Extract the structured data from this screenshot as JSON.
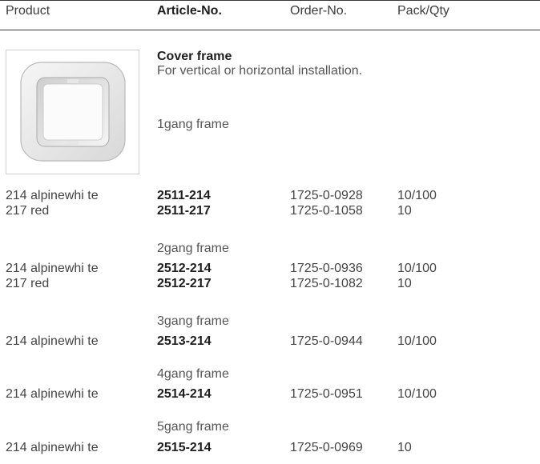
{
  "header": {
    "product": "Product",
    "article": "Article-No.",
    "order": "Order-No.",
    "pack": "Pack/Qty"
  },
  "item": {
    "title": "Cover frame",
    "description": "For vertical or horizontal installation.",
    "image_icon": "cover-frame-photo"
  },
  "groups": [
    {
      "label": "1gang frame",
      "rows": [
        {
          "product": "214 alpinewhi te",
          "article": "2511-214",
          "order": "1725-0-0928",
          "pack": "10/100"
        },
        {
          "product": "217 red",
          "article": "2511-217",
          "order": "1725-0-1058",
          "pack": "10"
        }
      ]
    },
    {
      "label": "2gang frame",
      "rows": [
        {
          "product": "214 alpinewhi te",
          "article": "2512-214",
          "order": "1725-0-0936",
          "pack": "10/100"
        },
        {
          "product": "217 red",
          "article": "2512-217",
          "order": "1725-0-1082",
          "pack": "10"
        }
      ]
    },
    {
      "label": "3gang frame",
      "rows": [
        {
          "product": "214 alpinewhi te",
          "article": "2513-214",
          "order": "1725-0-0944",
          "pack": "10/100"
        }
      ]
    },
    {
      "label": "4gang frame",
      "rows": [
        {
          "product": "214 alpinewhi te",
          "article": "2514-214",
          "order": "1725-0-0951",
          "pack": "10/100"
        }
      ]
    },
    {
      "label": "5gang frame",
      "rows": [
        {
          "product": "214 alpinewhi te",
          "article": "2515-214",
          "order": "1725-0-0969",
          "pack": "10"
        }
      ]
    }
  ]
}
